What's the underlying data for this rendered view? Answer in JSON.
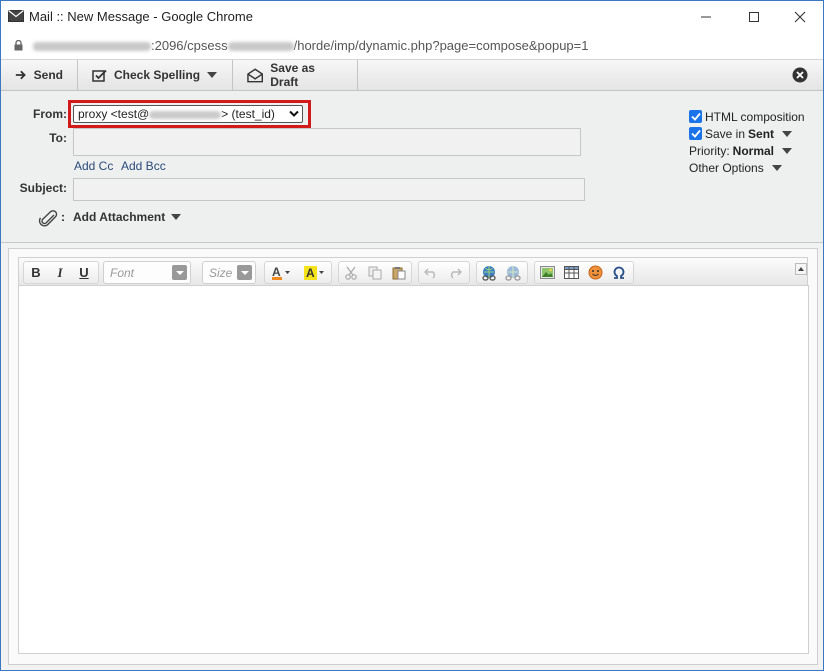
{
  "window": {
    "title": "Mail :: New Message - Google Chrome"
  },
  "url": {
    "host_suffix": ":2096/cpsess",
    "path": "/horde/imp/dynamic.php?page=compose&popup=1"
  },
  "toolbar": {
    "send_label": "Send",
    "check_spelling_label": "Check Spelling",
    "save_draft_label": "Save as Draft"
  },
  "compose": {
    "from_label": "From:",
    "from_value_start": "proxy <test@",
    "from_value_end": "> (test_id)",
    "to_label": "To:",
    "add_cc": "Add Cc",
    "add_bcc": "Add Bcc",
    "subject_label": "Subject:",
    "attach_colon": ":",
    "add_attachment": "Add Attachment"
  },
  "options": {
    "html_composition": "HTML composition",
    "save_in": "Save in",
    "save_in_value": "Sent",
    "priority": "Priority:",
    "priority_value": "Normal",
    "other_options": "Other Options"
  },
  "editor": {
    "bold": "B",
    "italic": "I",
    "underline": "U",
    "font_placeholder": "Font",
    "size_placeholder": "Size"
  },
  "colors": {
    "highlight_border": "#d31a1a",
    "checkbox": "#1a73e8",
    "window_border": "#3b78c4"
  }
}
